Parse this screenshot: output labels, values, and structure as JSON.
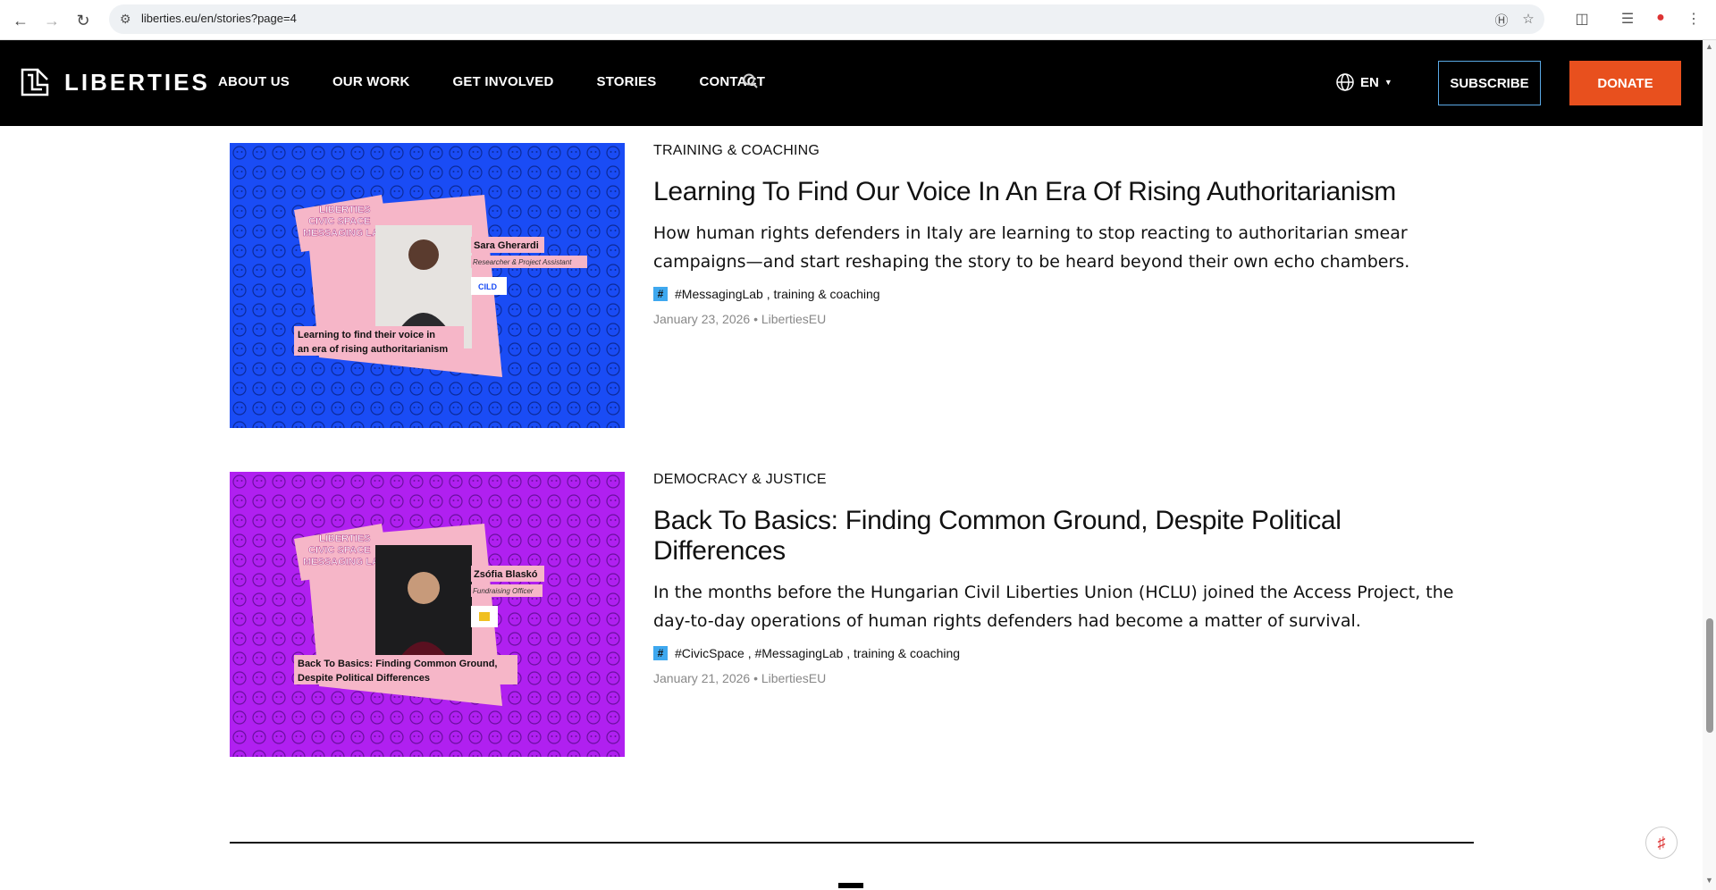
{
  "browser": {
    "url": "liberties.eu/en/stories?page=4",
    "icons": [
      "back-icon",
      "forward-icon",
      "reload-icon",
      "site-settings-icon",
      "translate-icon",
      "bookmark-star-icon",
      "extensions-icon",
      "media-controls-icon",
      "profile-icon",
      "menu-icon"
    ]
  },
  "header": {
    "logo_text": "LIBERTIES",
    "nav": [
      "ABOUT US",
      "OUR WORK",
      "GET INVOLVED",
      "STORIES",
      "CONTACT"
    ],
    "lang": "EN",
    "subscribe_label": "SUBSCRIBE",
    "donate_label": "DONATE",
    "colors": {
      "background": "#000000",
      "donate": "#e8501e",
      "subscribe_border": "#5aa9e6"
    }
  },
  "stories": [
    {
      "category": "TRAINING & COACHING",
      "title": "Learning To Find Our Voice In An Era Of Rising Authoritarianism",
      "excerpt": "How human rights defenders in Italy are learning to stop reacting to authoritarian smear campaigns—and start reshaping the story to be heard beyond their own echo chambers.",
      "tags": "#MessagingLab , training & coaching",
      "meta": "January 23, 2026 • LibertiesEU",
      "thumb": {
        "bg": "#1a4cf5",
        "lab_label": "LIBERTIES CIVIC SPACE MESSAGING LAB",
        "person_name": "Sara Gherardi",
        "person_role": "Researcher & Project Assistant",
        "org": "CILD",
        "caption_line1": "Learning to find their voice in",
        "caption_line2": "an era of rising authoritarianism"
      }
    },
    {
      "category": "DEMOCRACY & JUSTICE",
      "title": "Back To Basics: Finding Common Ground, Despite Political Differences",
      "excerpt": "In the months before the Hungarian Civil Liberties Union (HCLU) joined the Access Project, the day-to-day operations of human rights defenders had become a matter of survival.",
      "tags": "#CivicSpace , #MessagingLab , training & coaching",
      "meta": "January 21, 2026 • LibertiesEU",
      "thumb": {
        "bg": "#b020f0",
        "lab_label": "LIBERTIES CIVIC SPACE MESSAGING LAB",
        "person_name": "Zsófia Blaskó",
        "person_role": "Fundraising Officer",
        "org": "",
        "caption_line1": "Back To Basics: Finding Common Ground,",
        "caption_line2": "Despite Political Differences"
      }
    }
  ]
}
